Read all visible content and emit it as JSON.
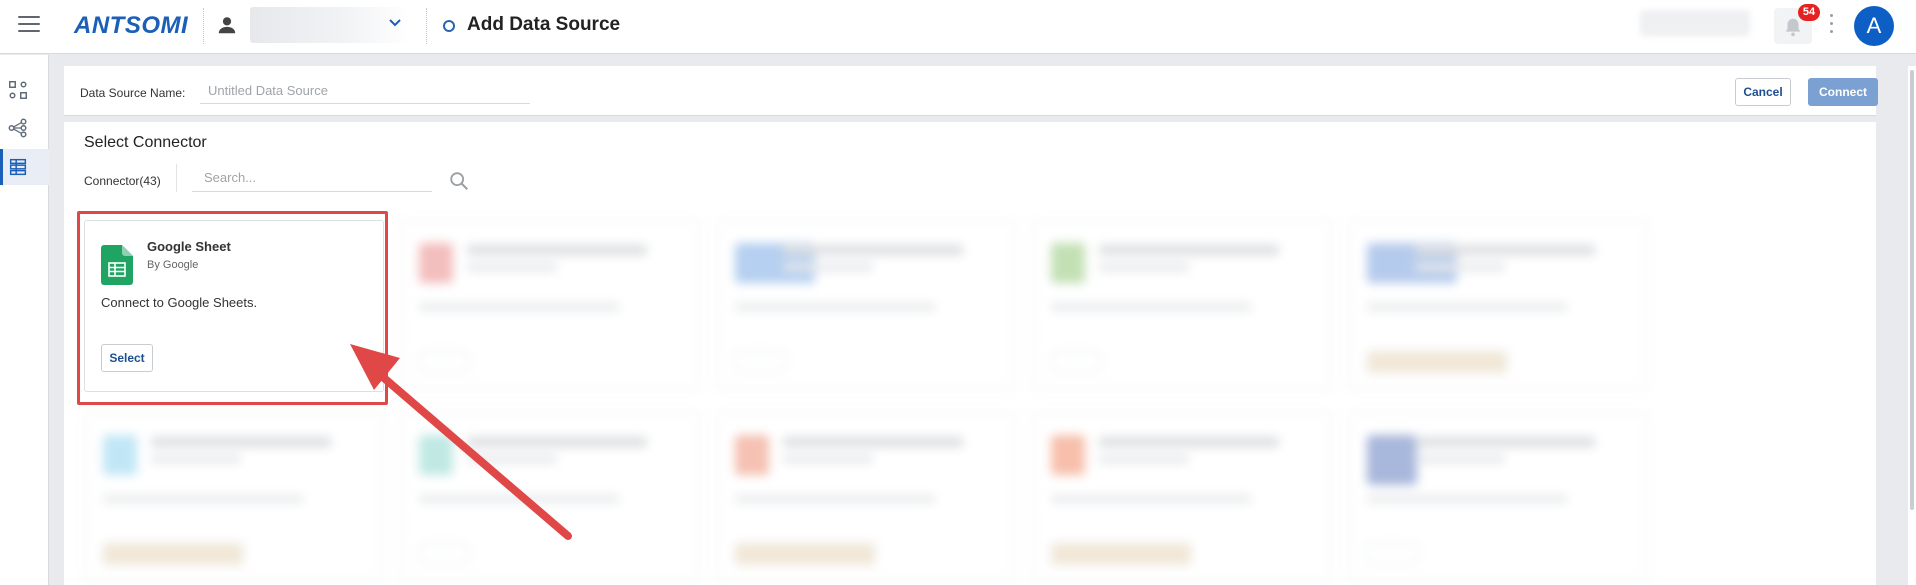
{
  "header": {
    "logo_text": "ANTSOMI",
    "page_title": "Add Data Source",
    "notification_count": "54",
    "avatar_initial": "A"
  },
  "form": {
    "data_source_label": "Data Source Name:",
    "data_source_placeholder": "Untitled Data Source",
    "cancel_label": "Cancel",
    "connect_label": "Connect"
  },
  "connectors": {
    "section_title": "Select Connector",
    "count_label": "Connector(43)",
    "search_placeholder": "Search..."
  },
  "featured_card": {
    "name": "Google Sheet",
    "vendor": "By Google",
    "description": "Connect to Google Sheets.",
    "select_label": "Select",
    "icon": "google-sheets-icon"
  },
  "colors": {
    "brand": "#1c5fb8",
    "highlight": "#e04848",
    "sheets_green": "#1fa463",
    "connect_disabled": "#7aa1d2"
  }
}
